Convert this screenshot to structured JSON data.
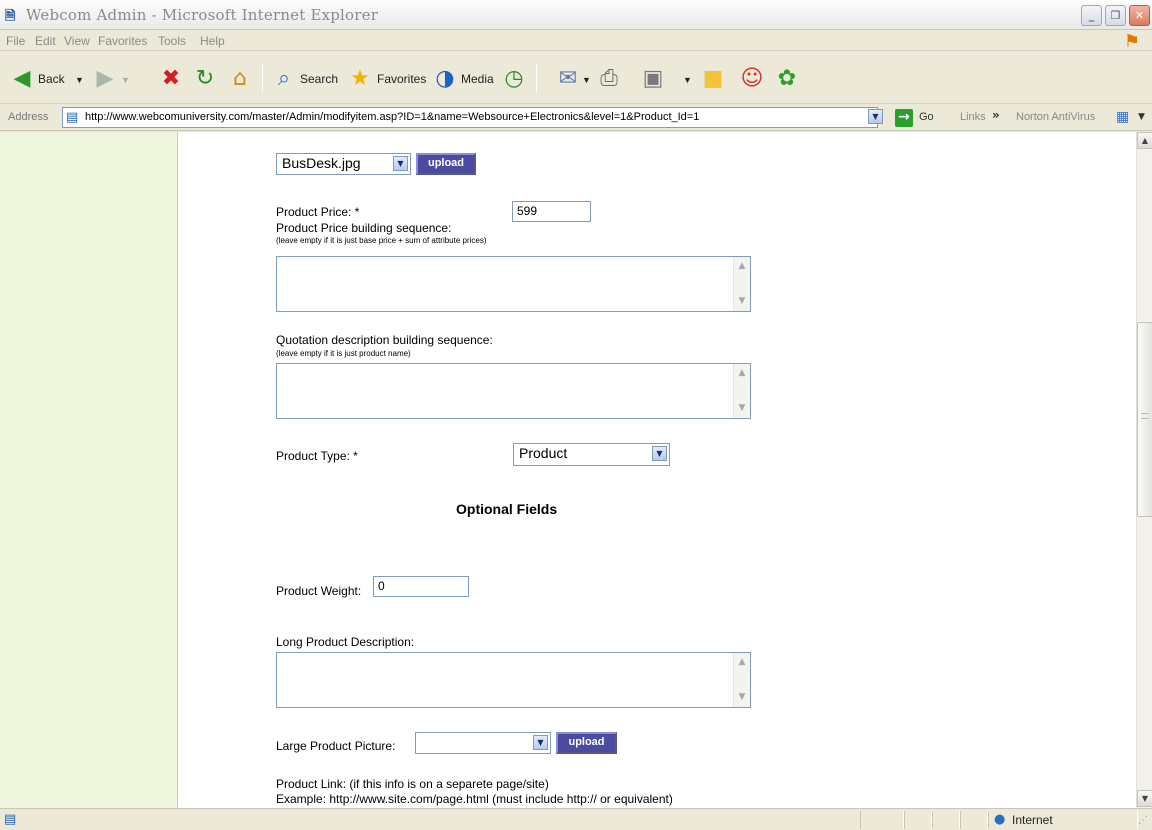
{
  "window": {
    "title": "Webcom Admin - Microsoft Internet Explorer",
    "app_icon": "ie-page-icon"
  },
  "menu": [
    "File",
    "Edit",
    "View",
    "Favorites",
    "Tools",
    "Help"
  ],
  "toolbar": {
    "back": "Back",
    "search": "Search",
    "favorites": "Favorites",
    "media": "Media"
  },
  "address": {
    "label": "Address",
    "url": "http://www.webcomuniversity.com/master/Admin/modifyitem.asp?ID=1&name=Websource+Electronics&level=1&Product_Id=1",
    "go": "Go",
    "links": "Links",
    "norton": "Norton AntiVirus"
  },
  "form": {
    "image_select": "BusDesk.jpg",
    "upload": "upload",
    "price_label": "Product Price: *",
    "price_value": "599",
    "price_seq_label": "Product Price building sequence:",
    "price_seq_note": "(leave empty if it is just base price + sum of attribute prices)",
    "quote_label": "Quotation description building sequence:",
    "quote_note": "(leave empty if it is just product name)",
    "type_label": "Product Type: *",
    "type_value": "Product",
    "optional_heading": "Optional Fields",
    "weight_label": "Product Weight:",
    "weight_value": "0",
    "long_desc_label": "Long Product Description:",
    "large_pic_label": "Large Product Picture:",
    "large_pic_value": "",
    "upload2": "upload",
    "link_label": "Product Link: (if this info is on a separete page/site)",
    "link_example": "Example: http://www.site.com/page.html (must include http:// or equivalent)"
  },
  "status": {
    "zone": "Internet"
  }
}
